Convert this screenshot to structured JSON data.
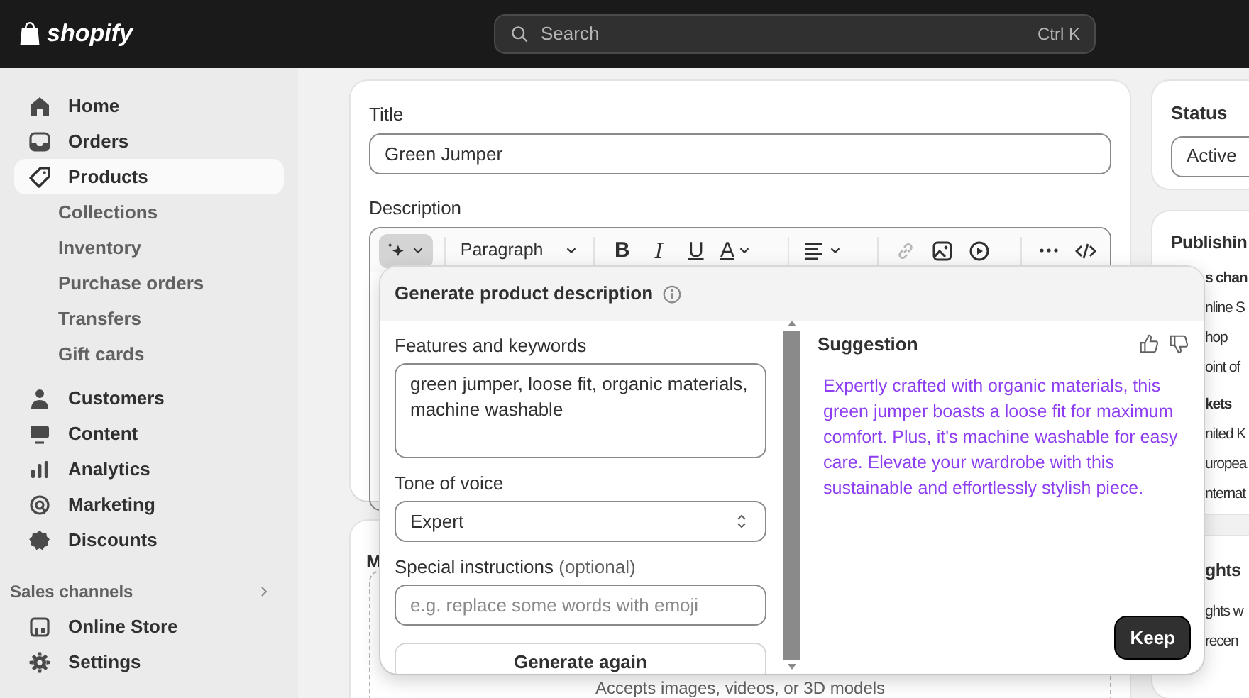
{
  "topbar": {
    "logo": "shopify",
    "search": {
      "placeholder": "Search",
      "shortcut": "Ctrl K"
    }
  },
  "sidebar": {
    "items": [
      {
        "label": "Home",
        "selected": false
      },
      {
        "label": "Orders",
        "selected": false
      },
      {
        "label": "Products",
        "selected": true,
        "children": [
          {
            "label": "Collections",
            "selected": false
          },
          {
            "label": "Inventory",
            "selected": false
          },
          {
            "label": "Purchase orders",
            "selected": false
          },
          {
            "label": "Transfers",
            "selected": false
          },
          {
            "label": "Gift cards",
            "selected": false
          }
        ]
      },
      {
        "label": "Customers",
        "selected": false
      },
      {
        "label": "Content",
        "selected": false
      },
      {
        "label": "Analytics",
        "selected": false
      },
      {
        "label": "Marketing",
        "selected": false
      },
      {
        "label": "Discounts",
        "selected": false
      }
    ],
    "sales_channels": {
      "title": "Sales channels",
      "items": [
        {
          "label": "Online Store",
          "selected": false
        },
        {
          "label": "Settings",
          "selected": false
        }
      ]
    }
  },
  "product": {
    "title": {
      "label": "Title",
      "value": "Green Jumper"
    },
    "description": {
      "label": "Description",
      "toolbar": [
        {
          "kind": "ai",
          "disabled": false
        },
        {
          "kind": "sep"
        },
        {
          "kind": "select",
          "label": "Paragraph",
          "disabled": false
        },
        {
          "kind": "sep"
        },
        {
          "kind": "bold",
          "label": "B",
          "disabled": false
        },
        {
          "kind": "italic",
          "label": "I",
          "disabled": false
        },
        {
          "kind": "underline",
          "label": "U",
          "disabled": false
        },
        {
          "kind": "color",
          "label": "A",
          "disabled": false
        },
        {
          "kind": "sep"
        },
        {
          "kind": "align",
          "disabled": false
        },
        {
          "kind": "sep"
        },
        {
          "kind": "link",
          "disabled": true
        },
        {
          "kind": "image",
          "disabled": false
        },
        {
          "kind": "video",
          "disabled": false
        },
        {
          "kind": "sep"
        },
        {
          "kind": "more",
          "disabled": false
        },
        {
          "kind": "code",
          "disabled": false
        }
      ]
    }
  },
  "media": {
    "title_fragment": "M",
    "hint": "Accepts images, videos, or 3D models"
  },
  "generator": {
    "title": "Generate product description",
    "features": {
      "label": "Features and keywords",
      "value": "green jumper, loose fit, organic materials, machine washable"
    },
    "tone": {
      "label": "Tone of voice",
      "value": "Expert"
    },
    "instructions": {
      "label": "Special instructions",
      "hint": "(optional)",
      "placeholder": "e.g. replace some words with emoji"
    },
    "generate_button": "Generate again",
    "suggestion": {
      "title": "Suggestion",
      "text": "Expertly crafted with organic materials, this green jumper boasts a loose fit for maximum comfort. Plus, it's machine washable for easy care. Elevate your wardrobe with this sustainable and effortlessly stylish piece.",
      "keep_button": "Keep"
    }
  },
  "status": {
    "title": "Status",
    "value": "Active"
  },
  "publishing": {
    "title": "Publishin",
    "lines": [
      {
        "kind": "heading",
        "text": "s chan"
      },
      {
        "kind": "item",
        "text": "nline S"
      },
      {
        "kind": "item",
        "text": "hop"
      },
      {
        "kind": "item",
        "text": "oint of"
      },
      {
        "kind": "heading",
        "text": "kets"
      },
      {
        "kind": "item",
        "text": "nited K"
      },
      {
        "kind": "item",
        "text": "uropea"
      },
      {
        "kind": "item",
        "text": "nternat"
      }
    ]
  },
  "insights": {
    "title": "ghts",
    "lines": [
      {
        "kind": "item",
        "text": "ghts w"
      },
      {
        "kind": "item",
        "text": "recen"
      }
    ]
  }
}
